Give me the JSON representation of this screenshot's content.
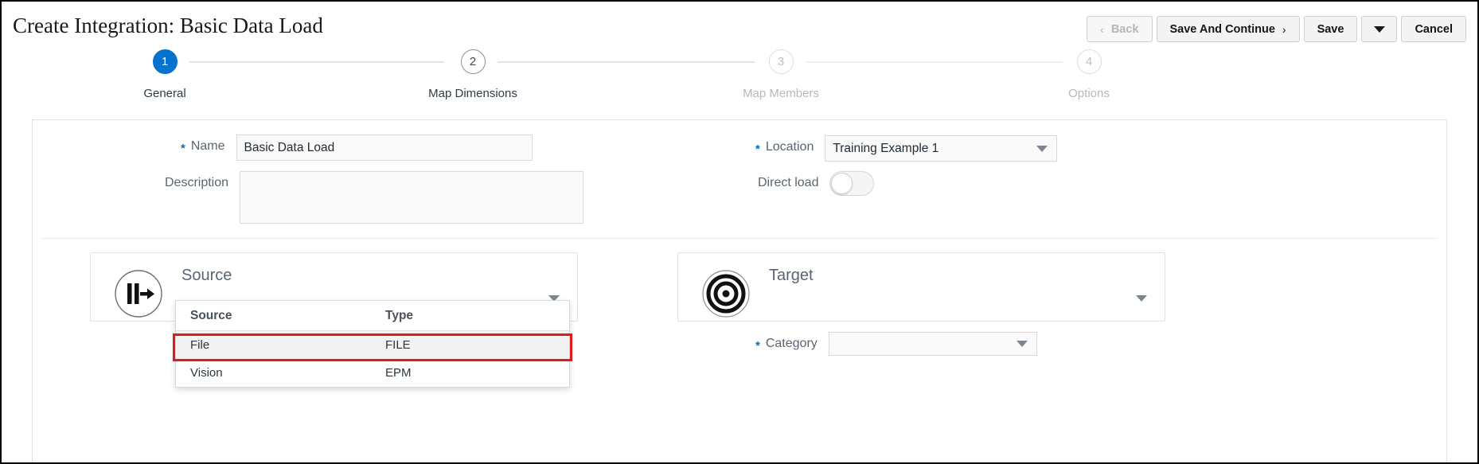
{
  "header": {
    "title": "Create Integration: Basic Data Load",
    "buttons": {
      "back": "Back",
      "save_and_continue": "Save And Continue",
      "save": "Save",
      "cancel": "Cancel"
    }
  },
  "stepper": {
    "steps": [
      {
        "number": "1",
        "label": "General",
        "state": "active"
      },
      {
        "number": "2",
        "label": "Map Dimensions",
        "state": "next"
      },
      {
        "number": "3",
        "label": "Map Members",
        "state": "dim"
      },
      {
        "number": "4",
        "label": "Options",
        "state": "dim"
      }
    ]
  },
  "form": {
    "name": {
      "label": "Name",
      "required": true,
      "value": "Basic Data Load"
    },
    "description": {
      "label": "Description",
      "required": false,
      "value": ""
    },
    "location": {
      "label": "Location",
      "required": true,
      "value": "Training Example 1"
    },
    "direct_load": {
      "label": "Direct load",
      "state": "off"
    },
    "category": {
      "label": "Category",
      "required": true,
      "value": ""
    }
  },
  "source_card": {
    "title": "Source",
    "icon": "source-flow-icon"
  },
  "target_card": {
    "title": "Target",
    "icon": "bullseye-target-icon"
  },
  "source_dropdown": {
    "columns": {
      "source": "Source",
      "type": "Type"
    },
    "rows": [
      {
        "source": "File",
        "type": "FILE",
        "selected": true
      },
      {
        "source": "Vision",
        "type": "EPM",
        "selected": false
      }
    ]
  },
  "annotation": {
    "highlight_color": "#e01b1b",
    "target_row": "File"
  },
  "colors": {
    "accent_blue": "#0572ce",
    "required_star": "#0c6cb5",
    "highlight_red": "#e01b1b"
  }
}
